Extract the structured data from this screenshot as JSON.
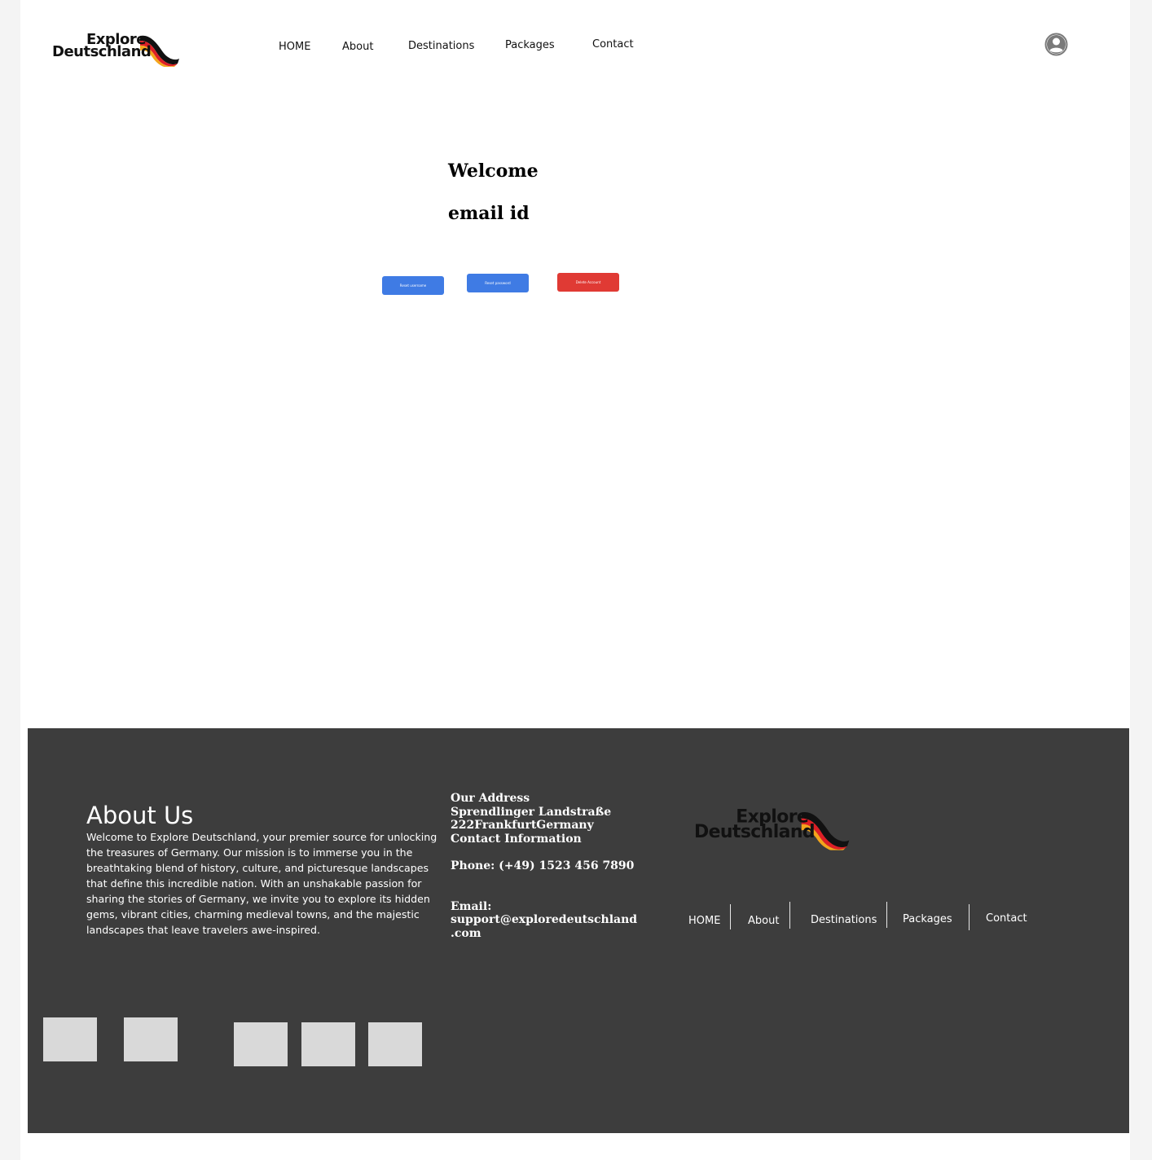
{
  "brand": {
    "logo_line1": "Explore",
    "logo_line2": "Deutschland",
    "flag_colors": [
      "#111111",
      "#dd1f26",
      "#f4a51c"
    ]
  },
  "header": {
    "nav": [
      "HOME",
      "About",
      "Destinations",
      "Packages",
      "Contact"
    ],
    "user_icon": "user-circle-icon"
  },
  "main": {
    "welcome": "Welcome",
    "email_label": "email id",
    "buttons": [
      "Reset username",
      "Reset password",
      "Delete Account"
    ],
    "colors": {
      "primary": "#3f7be4",
      "danger": "#e03a34"
    }
  },
  "footer": {
    "about_title": "About Us",
    "about_text": "Welcome to Explore Deutschland, your premier source for unlocking the treasures of Germany. Our mission is to immerse you in the breathtaking blend of history, culture, and picturesque landscapes that define this incredible nation. With an unshakable passion for sharing the stories of Germany, we invite you to explore its hidden gems, vibrant cities, charming medieval towns, and the majestic landscapes that leave travelers awe-inspired.",
    "address_title": "Our Address",
    "address_line1": "Sprendlinger Landstraße",
    "address_line2": "222FrankfurtGermany",
    "contact_title": "Contact Information",
    "phone": "Phone: (+49) 1523 456 7890",
    "email_label": "Email:",
    "email_line1": "support@exploredeutschland",
    "email_line2": ".com",
    "nav": [
      "HOME",
      "About",
      "Destinations",
      "Packages",
      "Contact"
    ],
    "background": "#3d3d3d"
  }
}
